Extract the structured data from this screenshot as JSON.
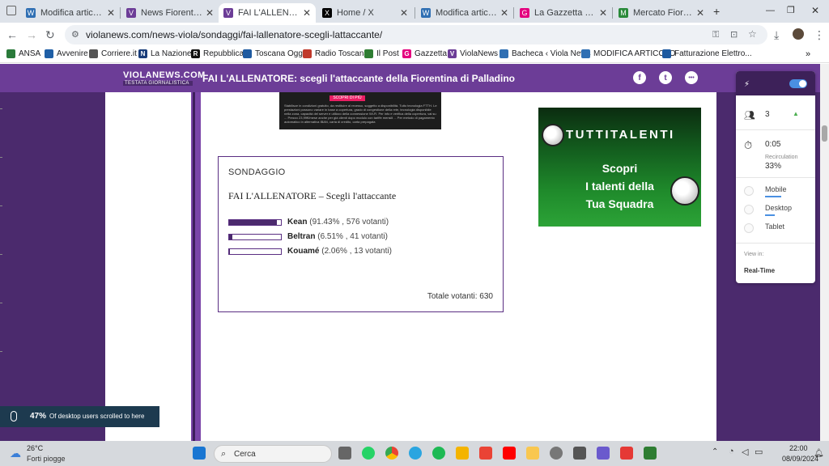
{
  "browser": {
    "tabs": [
      {
        "title": "Modifica articolo ‹ Vi",
        "fav_color": "#2f6fb3",
        "fav_icon": "wordpress-icon"
      },
      {
        "title": "News Fiorentina: agg",
        "fav_color": "#6c3d97",
        "fav_icon": "violanews-icon"
      },
      {
        "title": "FAI L'ALLENATORE: s",
        "fav_color": "#6c3d97",
        "fav_icon": "violanews-icon"
      },
      {
        "title": "Home / X",
        "fav_color": "#000000",
        "fav_icon": "x-icon"
      },
      {
        "title": "Modifica articolo ‹ Vi",
        "fav_color": "#2f6fb3",
        "fav_icon": "wordpress-icon"
      },
      {
        "title": "La Gazzetta dello Spo",
        "fav_color": "#e4007e",
        "fav_icon": "gazzetta-icon"
      },
      {
        "title": "Mercato Fiorentina: ı",
        "fav_color": "#2a8a3a",
        "fav_icon": "mercato-icon"
      }
    ],
    "new_tab_label": "+",
    "url": "violanews.com/news-viola/sondaggi/fai-lallenatore-scegli-lattaccante/",
    "bookmarks": [
      {
        "label": "ANSA",
        "color": "#2a7a3a"
      },
      {
        "label": "Avvenire",
        "color": "#1f5fa6"
      },
      {
        "label": "Corriere.it",
        "color": "#555555"
      },
      {
        "label": "La Nazione",
        "color": "#1a3d7a"
      },
      {
        "label": "Repubblica",
        "color": "#111111"
      },
      {
        "label": "Toscana Oggi",
        "color": "#1e5aa0"
      },
      {
        "label": "Radio Toscana",
        "color": "#c0392b"
      },
      {
        "label": "Il Post",
        "color": "#2e7d32"
      },
      {
        "label": "Gazzetta",
        "color": "#e4007e"
      },
      {
        "label": "ViolaNews",
        "color": "#6c3d97"
      },
      {
        "label": "Bacheca ‹ Viola News",
        "color": "#2f6fb3"
      },
      {
        "label": "MODIFICA ARTICOLO",
        "color": "#2f6fb3"
      },
      {
        "label": "Fatturazione Elettro...",
        "color": "#1e5aa0"
      }
    ]
  },
  "site": {
    "logo_main": "VIOLANEWS.COM",
    "logo_sub": "TESTATA GIORNALISTICA",
    "headline": "FAI L'ALLENATORE: scegli l'attaccante della Fiorentina di Palladino",
    "social": [
      "f",
      "t",
      "•••"
    ],
    "top_ad_button": "SCOPRI DI PIÙ",
    "top_ad_text": "Stabilisce in condizioni gratuito, da restituire al recesso, soggetto a disponibilità. Tutto tecnologia FTTH. Le prestazioni possono variare in base a copertura, grado di congestione della rete, tecnologia disponibile nella zona, capacità del server e utilizzo della connessione Wi-Fi. Per info e verifica della copertura, vai su ... Prezzo 23,99€/mese anche per già clienti dopo modulo con tariffe mensili ... Per metodo di pagamento automatico in alternativa IBAN, carta di credito, carta prepagata"
  },
  "poll": {
    "label": "SONDAGGIO",
    "title": "FAI L'ALLENATORE – Scegli l'attaccante",
    "options": [
      {
        "name": "Kean",
        "percent": 91.43,
        "stat": "(91.43% , 576 votanti)"
      },
      {
        "name": "Beltran",
        "percent": 6.51,
        "stat": "(6.51% , 41 votanti)"
      },
      {
        "name": "Kouamé",
        "percent": 2.06,
        "stat": "(2.06% , 13 votanti)"
      }
    ],
    "total": "Totale votanti: 630"
  },
  "ad": {
    "brand": "TUTTITALENTI",
    "line1": "Scopri",
    "line2": "I talenti della",
    "line3": "Tua Squadra"
  },
  "extension": {
    "visitors": "3",
    "time": "0:05",
    "recirculation_label": "Recirculation",
    "recirculation_value": "33%",
    "devices": [
      "Mobile",
      "Desktop",
      "Tablet"
    ],
    "device_share": [
      0.5,
      0.3,
      0.0
    ],
    "view_in_label": "View in:",
    "view_in_value": "Real-Time"
  },
  "scroll_note": {
    "percent": "47%",
    "message": "Of desktop users scrolled to here"
  },
  "taskbar": {
    "temp": "26°C",
    "weather": "Forti piogge",
    "search_placeholder": "Cerca",
    "time": "22:00",
    "date": "08/09/2024"
  }
}
